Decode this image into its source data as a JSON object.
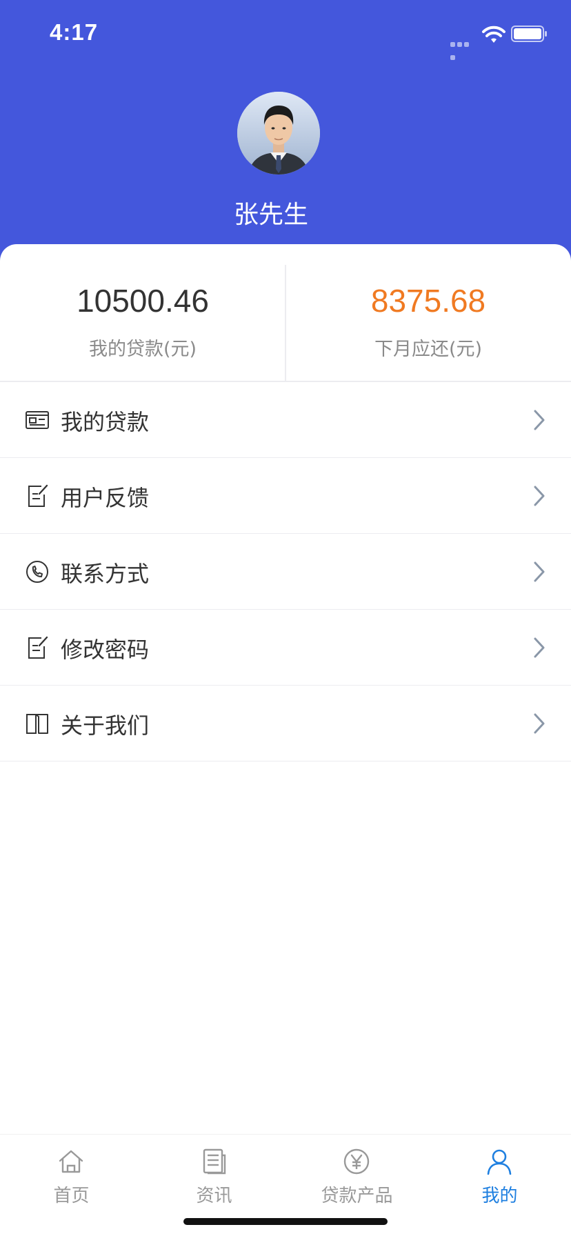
{
  "status_bar": {
    "time": "4:17"
  },
  "profile": {
    "name": "张先生"
  },
  "stats": {
    "loan_value": "10500.46",
    "loan_label": "我的贷款(元)",
    "next_value": "8375.68",
    "next_label": "下月应还(元)",
    "loan_color": "#333333",
    "next_color": "#f07a22"
  },
  "menu": {
    "items": [
      {
        "label": "我的贷款",
        "icon": "id-card-icon"
      },
      {
        "label": "用户反馈",
        "icon": "edit-note-icon"
      },
      {
        "label": "联系方式",
        "icon": "phone-icon"
      },
      {
        "label": "修改密码",
        "icon": "edit-note-icon"
      },
      {
        "label": "关于我们",
        "icon": "book-icon"
      }
    ]
  },
  "tabbar": {
    "tabs": [
      {
        "label": "首页",
        "icon": "home-icon"
      },
      {
        "label": "资讯",
        "icon": "news-icon"
      },
      {
        "label": "贷款产品",
        "icon": "yen-icon"
      },
      {
        "label": "我的",
        "icon": "user-icon"
      }
    ],
    "active_index": 3
  },
  "colors": {
    "header_bg": "#4457dc",
    "accent_active_tab": "#1e7fe0",
    "highlight_orange": "#f07a22"
  }
}
